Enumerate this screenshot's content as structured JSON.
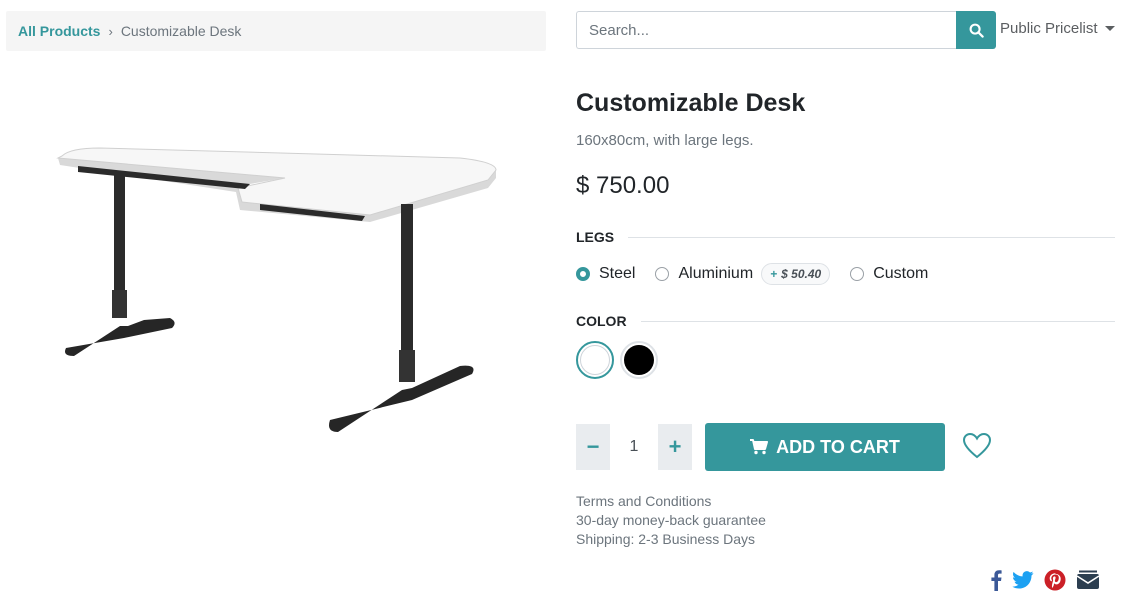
{
  "breadcrumb": {
    "parent": "All Products",
    "separator": "›",
    "current": "Customizable Desk"
  },
  "search": {
    "placeholder": "Search...",
    "value": "",
    "icon": "search-icon"
  },
  "pricelist": {
    "label": "Public Pricelist"
  },
  "product": {
    "name": "Customizable Desk",
    "description": "160x80cm, with large legs.",
    "price": "$ 750.00",
    "image": "desk-image"
  },
  "legs": {
    "heading": "LEGS",
    "options": [
      {
        "label": "Steel",
        "selected": true
      },
      {
        "label": "Aluminium",
        "selected": false,
        "extra_plus": "+",
        "extra": "$ 50.40"
      },
      {
        "label": "Custom",
        "selected": false
      }
    ]
  },
  "color": {
    "heading": "COLOR",
    "swatches": [
      {
        "name": "White",
        "hex": "#ffffff",
        "selected": true
      },
      {
        "name": "Black",
        "hex": "#000000",
        "selected": false
      }
    ]
  },
  "quantity": {
    "value": "1",
    "minus": "−",
    "plus": "+"
  },
  "cart": {
    "label": "ADD TO CART",
    "icon": "cart-icon"
  },
  "wishlist": {
    "icon": "heart-icon"
  },
  "info": {
    "terms": "Terms and Conditions",
    "guarantee": "30-day money-back guarantee",
    "shipping": "Shipping: 2-3 Business Days"
  },
  "share": [
    "facebook-icon",
    "twitter-icon",
    "pinterest-icon",
    "email-icon"
  ],
  "colors": {
    "accent": "#35979c",
    "facebook": "#3b5998",
    "twitter": "#1da1f2",
    "pinterest": "#cb2027",
    "email": "#2c3e50"
  }
}
